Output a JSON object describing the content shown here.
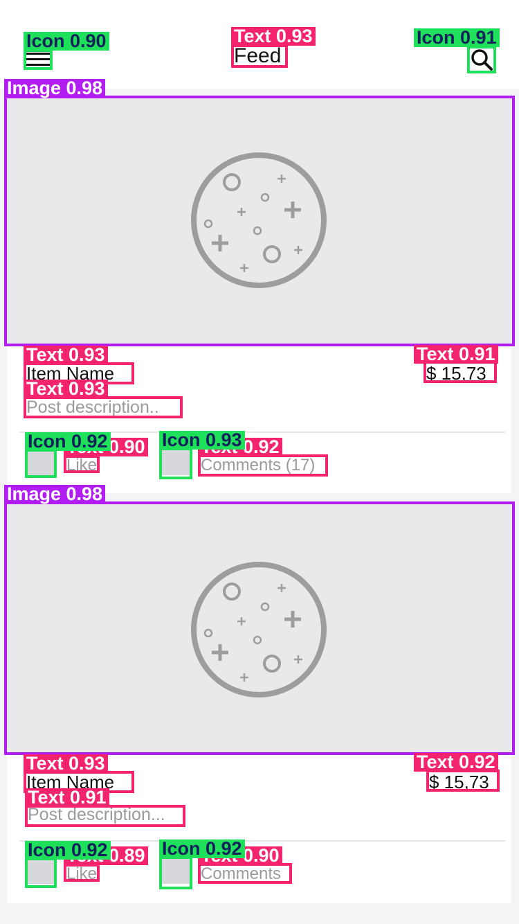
{
  "header": {
    "title": "Feed",
    "menu_icon": "menu-icon",
    "search_icon": "search-icon"
  },
  "posts": [
    {
      "item_name": "Item Name",
      "price": "$ 15,73",
      "description": "Post description..",
      "like_label": "Like",
      "comments_label": "Comments (17)"
    },
    {
      "item_name": "Item Name",
      "price": "$ 15,73",
      "description": "Post description...",
      "like_label": "Like",
      "comments_label": "Comments"
    }
  ],
  "annotations": {
    "icon_menu": "Icon 0.90",
    "text_title": "Text 0.93",
    "icon_search": "Icon 0.91",
    "image1": "Image 0.98",
    "p1_name": "Text 0.93",
    "p1_price": "Text 0.91",
    "p1_desc": "Text 0.93",
    "p1_like_icon": "Icon 0.92",
    "p1_like_text": "Text 0.90",
    "p1_comment_icon": "Icon 0.93",
    "p1_comment_text": "Text 0.92",
    "image2": "Image 0.98",
    "p2_name": "Text 0.93",
    "p2_price": "Text 0.92",
    "p2_desc": "Text 0.91",
    "p2_like_icon": "Icon 0.92",
    "p2_like_text": "Text 0.89",
    "p2_comment_icon": "Icon 0.92",
    "p2_comment_text": "Text 0.90"
  },
  "colors": {
    "icon_box": "#1fe05a",
    "text_box": "#f3246d",
    "image_box": "#b21ef2"
  }
}
